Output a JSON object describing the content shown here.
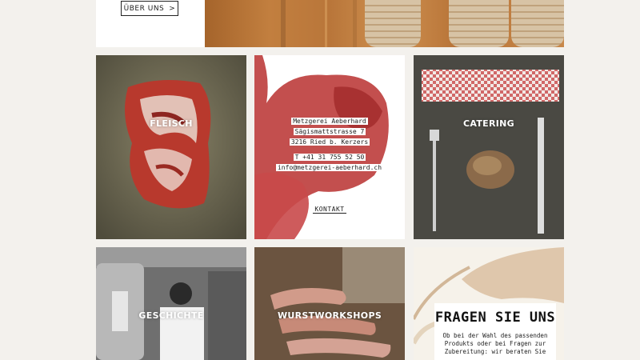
{
  "top": {
    "about_label": "ÜBER UNS",
    "about_arrow": ">"
  },
  "tiles": {
    "fleisch": {
      "label": "FLEISCH"
    },
    "catering": {
      "label": "CATERING"
    },
    "geschichte": {
      "label": "GESCHICHTE"
    },
    "wurst": {
      "label": "WURSTWORKSHOPS"
    }
  },
  "contact": {
    "name": "Metzgerei Aeberhard",
    "street": "Sägismattstrasse 7",
    "city": "3216 Ried b. Kerzers",
    "phone": "T +41 31 755 52 50",
    "email": "info@metzgerei-aeberhard.ch",
    "link_label": "KONTAKT"
  },
  "fragen": {
    "title": "FRAGEN SIE UNS",
    "text": "Ob bei der Wahl des passenden Produkts oder bei Fragen zur Zubereitung: wir beraten Sie"
  },
  "colors": {
    "page_bg": "#f3f1ed",
    "accent_text": "#222222"
  }
}
